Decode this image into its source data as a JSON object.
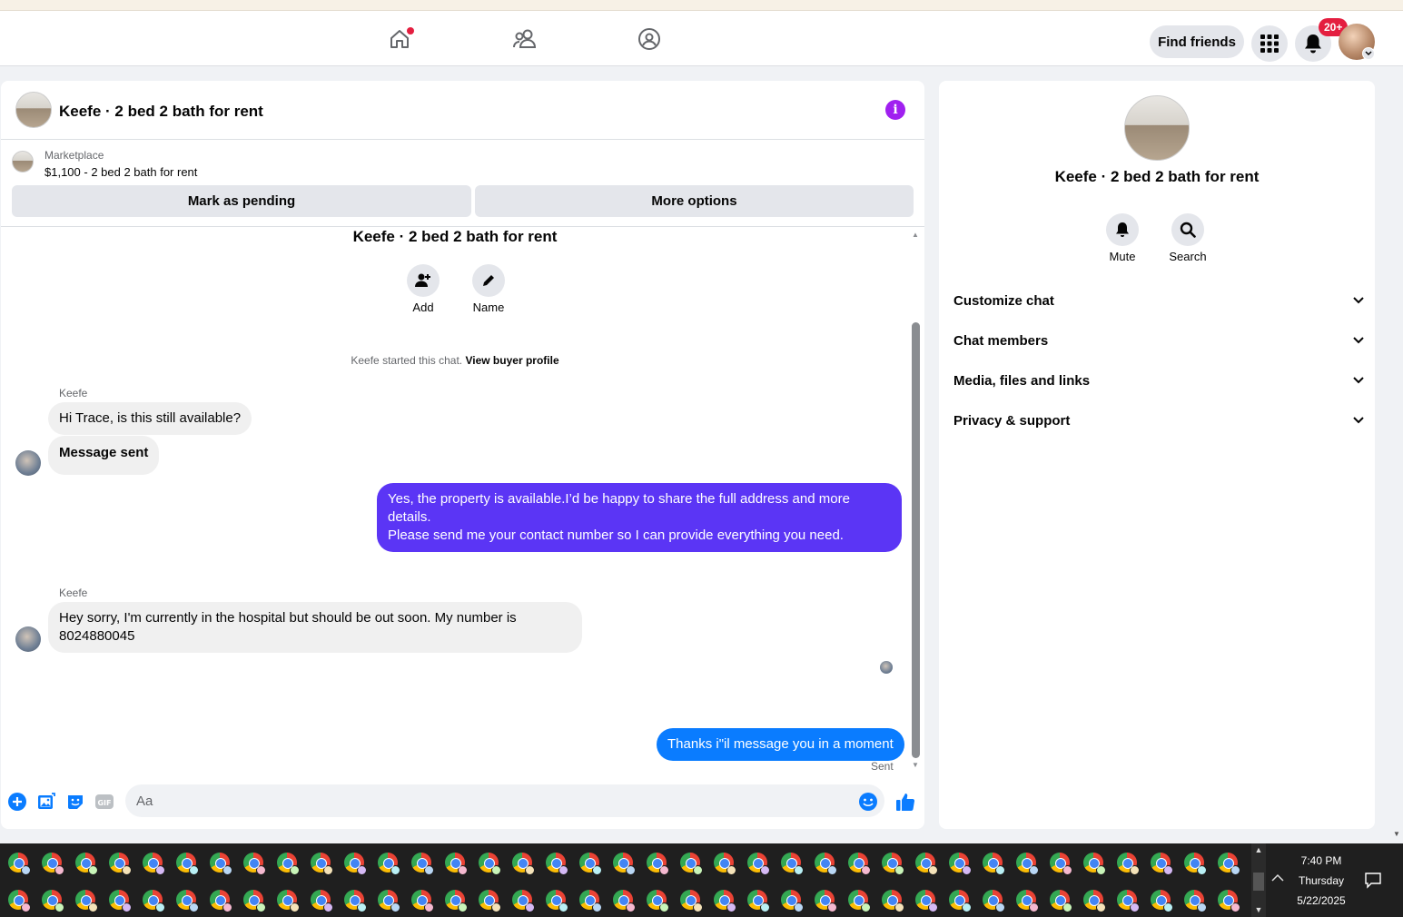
{
  "topbar": {
    "find_friends_label": "Find friends",
    "notification_count": "20+"
  },
  "chat": {
    "title": "Keefe · 2 bed 2 bath for rent",
    "marketplace_label": "Marketplace",
    "listing": "$1,100 - 2 bed 2 bath for rent",
    "mark_pending_label": "Mark as pending",
    "more_options_label": "More options",
    "center_title": "Keefe · 2 bed 2 bath for rent",
    "add_label": "Add",
    "name_label": "Name",
    "system_text": "Keefe started this chat.",
    "system_link": "View buyer profile",
    "messages": [
      {
        "sender": "Keefe",
        "text": "Hi Trace, is this still available?"
      },
      {
        "text": "Message sent"
      },
      {
        "text": "Yes, the property is available.I’d be happy to share the full address and more details.",
        "text2": "Please send me your contact number so I can provide everything you need."
      },
      {
        "sender": "Keefe",
        "text": "Hey sorry, I'm currently in the hospital but should be out soon. My number is",
        "text2": "8024880045"
      },
      {
        "text": "Thanks i\"il message you in a moment"
      }
    ],
    "sent_status": "Sent",
    "input_placeholder": "Aa",
    "colors": {
      "outgoing_purple": "#5b35f5",
      "outgoing_blue": "#0a7cff",
      "info_purple": "#a020f0"
    }
  },
  "info_panel": {
    "title": "Keefe · 2 bed 2 bath for rent",
    "mute_label": "Mute",
    "search_label": "Search",
    "sections": [
      "Customize chat",
      "Chat members",
      "Media, files and links",
      "Privacy & support"
    ]
  },
  "taskbar": {
    "time": "7:40 PM",
    "day": "Thursday",
    "date": "5/22/2025"
  }
}
